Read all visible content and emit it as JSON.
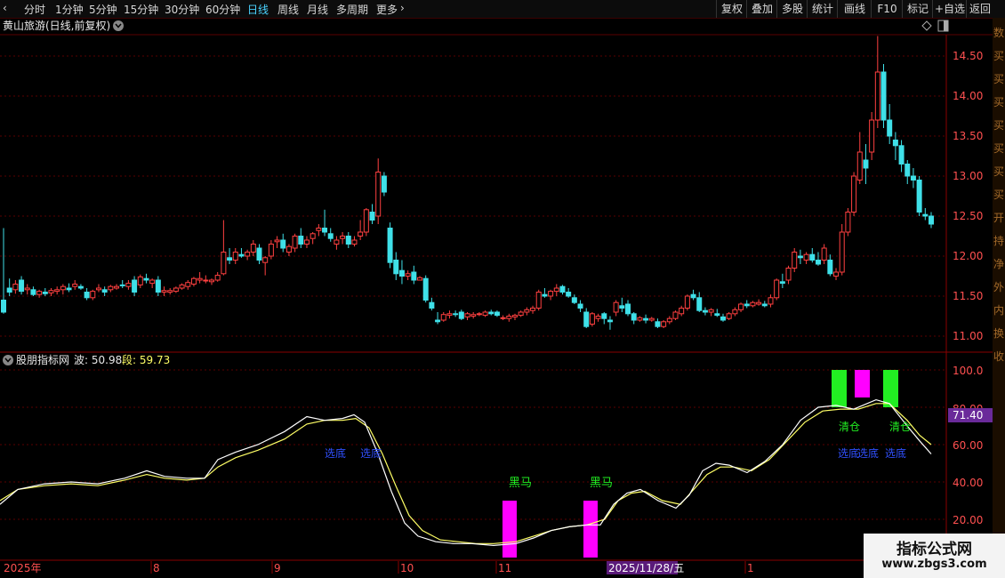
{
  "toolbar": {
    "left_items": [
      "分时",
      "1分钟",
      "5分钟",
      "15分钟",
      "30分钟",
      "60分钟",
      "日线",
      "周线",
      "月线",
      "多周期",
      "更多"
    ],
    "active": "日线",
    "right_items": [
      "复权",
      "叠加",
      "多股",
      "统计",
      "画线",
      "F10",
      "标记",
      "+自选",
      "返回"
    ]
  },
  "main_chart": {
    "title": "黄山旅游(日线,前复权)",
    "price_ticks": [
      "14.50",
      "14.00",
      "13.50",
      "13.00",
      "12.50",
      "12.00",
      "11.50",
      "11.00"
    ]
  },
  "indicator": {
    "name": "股朋指标网",
    "wave_label": "波: 50.98",
    "segment_label": "段: 59.73",
    "y_ticks": [
      "100.0",
      "80.00",
      "60.00",
      "40.00",
      "20.00"
    ],
    "current_value": "71.40",
    "signals": {
      "xuandi": "选底",
      "heima": "黑马",
      "qingcang": "清仓"
    }
  },
  "time_axis": {
    "labels": [
      "2025年",
      "8",
      "9",
      "10",
      "11",
      "1"
    ],
    "cursor_date": "2025/11/28/五"
  },
  "sidebar_chars": "数买买买买买买买开持净外内换收",
  "watermark": {
    "name": "指标公式网",
    "url": "www.zbgs3.com"
  },
  "colors": {
    "up": "#ff4040",
    "down": "#3fe0e8",
    "wave_line": "#ffffff",
    "segment_line": "#ffff66",
    "magenta": "#ff00ff",
    "green": "#22ee22",
    "signal_blue": "#3050ff",
    "grid": "#5a0000"
  },
  "chart_data": {
    "type": "candlestick",
    "title": "黄山旅游(日线,前复权)",
    "ylim": [
      10.85,
      14.85
    ],
    "ohlc": [
      [
        11.45,
        12.35,
        11.28,
        11.3
      ],
      [
        11.6,
        11.72,
        11.5,
        11.55
      ],
      [
        11.58,
        11.7,
        11.53,
        11.65
      ],
      [
        11.7,
        11.75,
        11.52,
        11.56
      ],
      [
        11.58,
        11.65,
        11.52,
        11.6
      ],
      [
        11.58,
        11.62,
        11.5,
        11.52
      ],
      [
        11.52,
        11.58,
        11.48,
        11.56
      ],
      [
        11.55,
        11.6,
        11.5,
        11.53
      ],
      [
        11.54,
        11.6,
        11.5,
        11.57
      ],
      [
        11.56,
        11.62,
        11.52,
        11.58
      ],
      [
        11.58,
        11.65,
        11.52,
        11.62
      ],
      [
        11.6,
        11.66,
        11.55,
        11.58
      ],
      [
        11.62,
        11.7,
        11.58,
        11.65
      ],
      [
        11.62,
        11.65,
        11.58,
        11.6
      ],
      [
        11.55,
        11.6,
        11.45,
        11.48
      ],
      [
        11.48,
        11.58,
        11.45,
        11.56
      ],
      [
        11.58,
        11.65,
        11.55,
        11.6
      ],
      [
        11.58,
        11.62,
        11.5,
        11.55
      ],
      [
        11.58,
        11.64,
        11.55,
        11.62
      ],
      [
        11.6,
        11.65,
        11.58,
        11.62
      ],
      [
        11.64,
        11.7,
        11.6,
        11.63
      ],
      [
        11.62,
        11.7,
        11.58,
        11.66
      ],
      [
        11.7,
        11.75,
        11.5,
        11.55
      ],
      [
        11.64,
        11.77,
        11.6,
        11.74
      ],
      [
        11.72,
        11.78,
        11.66,
        11.7
      ],
      [
        11.66,
        11.72,
        11.6,
        11.7
      ],
      [
        11.7,
        11.75,
        11.5,
        11.55
      ],
      [
        11.55,
        11.62,
        11.5,
        11.57
      ],
      [
        11.55,
        11.6,
        11.52,
        11.57
      ],
      [
        11.56,
        11.62,
        11.54,
        11.6
      ],
      [
        11.6,
        11.66,
        11.58,
        11.64
      ],
      [
        11.62,
        11.7,
        11.58,
        11.67
      ],
      [
        11.65,
        11.74,
        11.62,
        11.72
      ],
      [
        11.7,
        11.8,
        11.66,
        11.72
      ],
      [
        11.7,
        11.76,
        11.66,
        11.7
      ],
      [
        11.68,
        11.72,
        11.64,
        11.7
      ],
      [
        11.7,
        11.8,
        11.68,
        11.76
      ],
      [
        11.78,
        12.45,
        11.76,
        12.05
      ],
      [
        11.98,
        12.1,
        11.9,
        11.95
      ],
      [
        11.95,
        12.1,
        11.9,
        12.05
      ],
      [
        12.02,
        12.1,
        11.98,
        12.0
      ],
      [
        12.0,
        12.08,
        11.95,
        12.05
      ],
      [
        12.05,
        12.2,
        12.0,
        12.15
      ],
      [
        12.1,
        12.15,
        11.9,
        11.95
      ],
      [
        11.92,
        12.0,
        11.76,
        11.98
      ],
      [
        12.0,
        12.2,
        11.96,
        12.15
      ],
      [
        12.18,
        12.25,
        12.1,
        12.2
      ],
      [
        12.2,
        12.28,
        12.05,
        12.1
      ],
      [
        12.05,
        12.15,
        12.0,
        12.12
      ],
      [
        12.1,
        12.28,
        12.05,
        12.25
      ],
      [
        12.25,
        12.35,
        12.1,
        12.15
      ],
      [
        12.15,
        12.25,
        12.1,
        12.2
      ],
      [
        12.22,
        12.3,
        12.15,
        12.28
      ],
      [
        12.32,
        12.4,
        12.25,
        12.35
      ],
      [
        12.35,
        12.58,
        12.25,
        12.3
      ],
      [
        12.28,
        12.35,
        12.18,
        12.22
      ],
      [
        12.15,
        12.25,
        12.08,
        12.2
      ],
      [
        12.22,
        12.3,
        12.15,
        12.25
      ],
      [
        12.25,
        12.3,
        12.1,
        12.15
      ],
      [
        12.15,
        12.25,
        12.12,
        12.2
      ],
      [
        12.25,
        12.45,
        12.2,
        12.3
      ],
      [
        12.3,
        12.6,
        12.25,
        12.58
      ],
      [
        12.55,
        12.65,
        12.4,
        12.45
      ],
      [
        12.5,
        13.22,
        12.4,
        13.05
      ],
      [
        13.0,
        13.05,
        12.75,
        12.8
      ],
      [
        12.35,
        12.42,
        11.85,
        11.92
      ],
      [
        11.95,
        12.05,
        11.7,
        11.78
      ],
      [
        11.82,
        11.95,
        11.65,
        11.75
      ],
      [
        11.75,
        11.82,
        11.7,
        11.78
      ],
      [
        11.8,
        11.88,
        11.65,
        11.7
      ],
      [
        11.7,
        11.75,
        11.72,
        11.73
      ],
      [
        11.72,
        11.76,
        11.42,
        11.45
      ],
      [
        11.42,
        11.48,
        11.32,
        11.35
      ],
      [
        11.2,
        11.3,
        11.15,
        11.18
      ],
      [
        11.2,
        11.3,
        11.18,
        11.27
      ],
      [
        11.26,
        11.32,
        11.22,
        11.28
      ],
      [
        11.28,
        11.32,
        11.24,
        11.27
      ],
      [
        11.3,
        11.33,
        11.2,
        11.22
      ],
      [
        11.24,
        11.3,
        11.2,
        11.28
      ],
      [
        11.25,
        11.3,
        11.22,
        11.27
      ],
      [
        11.27,
        11.3,
        11.25,
        11.28
      ],
      [
        11.26,
        11.32,
        11.24,
        11.3
      ],
      [
        11.3,
        11.33,
        11.26,
        11.28
      ],
      [
        11.3,
        11.32,
        11.24,
        11.26
      ],
      [
        11.22,
        11.26,
        11.2,
        11.23
      ],
      [
        11.22,
        11.28,
        11.18,
        11.25
      ],
      [
        11.24,
        11.28,
        11.2,
        11.26
      ],
      [
        11.26,
        11.32,
        11.24,
        11.3
      ],
      [
        11.3,
        11.36,
        11.26,
        11.33
      ],
      [
        11.32,
        11.38,
        11.28,
        11.35
      ],
      [
        11.35,
        11.58,
        11.32,
        11.55
      ],
      [
        11.52,
        11.6,
        11.48,
        11.5
      ],
      [
        11.5,
        11.58,
        11.45,
        11.56
      ],
      [
        11.56,
        11.65,
        11.5,
        11.6
      ],
      [
        11.62,
        11.64,
        11.52,
        11.55
      ],
      [
        11.55,
        11.6,
        11.48,
        11.5
      ],
      [
        11.48,
        11.52,
        11.4,
        11.42
      ],
      [
        11.4,
        11.45,
        11.3,
        11.35
      ],
      [
        11.3,
        11.35,
        11.1,
        11.12
      ],
      [
        11.15,
        11.3,
        11.12,
        11.28
      ],
      [
        11.22,
        11.28,
        11.18,
        11.25
      ],
      [
        11.28,
        11.3,
        11.15,
        11.22
      ],
      [
        11.2,
        11.25,
        11.08,
        11.18
      ],
      [
        11.3,
        11.45,
        11.25,
        11.42
      ],
      [
        11.38,
        11.48,
        11.3,
        11.35
      ],
      [
        11.4,
        11.45,
        11.25,
        11.28
      ],
      [
        11.28,
        11.3,
        11.15,
        11.2
      ],
      [
        11.2,
        11.25,
        11.18,
        11.23
      ],
      [
        11.22,
        11.27,
        11.16,
        11.2
      ],
      [
        11.2,
        11.24,
        11.18,
        11.22
      ],
      [
        11.18,
        11.22,
        11.1,
        11.12
      ],
      [
        11.12,
        11.2,
        11.1,
        11.18
      ],
      [
        11.18,
        11.25,
        11.15,
        11.22
      ],
      [
        11.22,
        11.32,
        11.2,
        11.3
      ],
      [
        11.28,
        11.38,
        11.25,
        11.35
      ],
      [
        11.35,
        11.52,
        11.32,
        11.5
      ],
      [
        11.52,
        11.58,
        11.45,
        11.48
      ],
      [
        11.48,
        11.55,
        11.3,
        11.32
      ],
      [
        11.32,
        11.36,
        11.26,
        11.3
      ],
      [
        11.3,
        11.35,
        11.25,
        11.33
      ],
      [
        11.28,
        11.34,
        11.24,
        11.26
      ],
      [
        11.24,
        11.28,
        11.18,
        11.2
      ],
      [
        11.22,
        11.3,
        11.2,
        11.28
      ],
      [
        11.28,
        11.36,
        11.25,
        11.33
      ],
      [
        11.33,
        11.42,
        11.3,
        11.4
      ],
      [
        11.4,
        11.45,
        11.35,
        11.38
      ],
      [
        11.38,
        11.44,
        11.36,
        11.42
      ],
      [
        11.4,
        11.46,
        11.38,
        11.42
      ],
      [
        11.4,
        11.44,
        11.36,
        11.38
      ],
      [
        11.4,
        11.52,
        11.36,
        11.48
      ],
      [
        11.48,
        11.72,
        11.45,
        11.7
      ],
      [
        11.68,
        11.78,
        11.6,
        11.66
      ],
      [
        11.7,
        11.88,
        11.65,
        11.85
      ],
      [
        11.85,
        12.1,
        11.8,
        12.05
      ],
      [
        12.0,
        12.08,
        11.9,
        11.98
      ],
      [
        11.95,
        12.05,
        11.9,
        12.02
      ],
      [
        12.02,
        12.1,
        11.92,
        11.95
      ],
      [
        11.95,
        12.05,
        11.88,
        11.9
      ],
      [
        11.95,
        12.15,
        11.9,
        12.1
      ],
      [
        11.95,
        12.02,
        11.75,
        11.78
      ],
      [
        11.75,
        11.85,
        11.7,
        11.8
      ],
      [
        11.8,
        12.4,
        11.76,
        12.3
      ],
      [
        12.3,
        12.6,
        12.25,
        12.55
      ],
      [
        12.55,
        13.05,
        12.5,
        13.0
      ],
      [
        12.95,
        13.55,
        12.9,
        13.3
      ],
      [
        13.2,
        13.4,
        12.9,
        13.1
      ],
      [
        13.3,
        13.8,
        13.2,
        13.7
      ],
      [
        13.7,
        14.75,
        13.6,
        14.3
      ],
      [
        14.3,
        14.4,
        13.6,
        13.7
      ],
      [
        13.7,
        13.9,
        13.4,
        13.5
      ],
      [
        13.45,
        13.55,
        13.2,
        13.38
      ],
      [
        13.38,
        13.45,
        13.05,
        13.15
      ],
      [
        13.15,
        13.2,
        12.9,
        13.0
      ],
      [
        13.0,
        13.1,
        12.85,
        12.95
      ],
      [
        12.95,
        13.0,
        12.5,
        12.55
      ],
      [
        12.52,
        12.6,
        12.45,
        12.5
      ],
      [
        12.5,
        12.55,
        12.35,
        12.4
      ]
    ],
    "indicator_series": [
      {
        "name": "波",
        "last": 50.98
      },
      {
        "name": "段",
        "last": 59.73
      }
    ],
    "indicator_ylim": [
      0,
      110
    ]
  }
}
